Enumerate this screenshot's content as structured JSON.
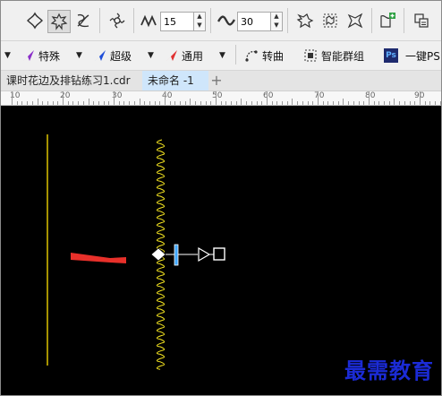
{
  "toolbar1": {
    "amplitude_value": "15",
    "frequency_value": "30"
  },
  "toolbar2": {
    "items": [
      {
        "label": "特殊"
      },
      {
        "label": "超级"
      },
      {
        "label": "通用"
      },
      {
        "label": "转曲"
      },
      {
        "label": "智能群组"
      },
      {
        "label": "一键PS"
      }
    ],
    "ps_badge": "Ps"
  },
  "tabs": [
    {
      "label": "课时花边及排钻练习1.cdr"
    },
    {
      "label": "未命名 -1"
    }
  ],
  "ruler": {
    "labels": [
      "10",
      "20",
      "30",
      "40",
      "50",
      "60",
      "70",
      "80",
      "90"
    ]
  },
  "canvas": {
    "background": "#000000",
    "line_color": "#b8a200",
    "zigzag_color": "#f0e020",
    "arrow_color": "#e8302a",
    "watermark": "最需教育"
  }
}
